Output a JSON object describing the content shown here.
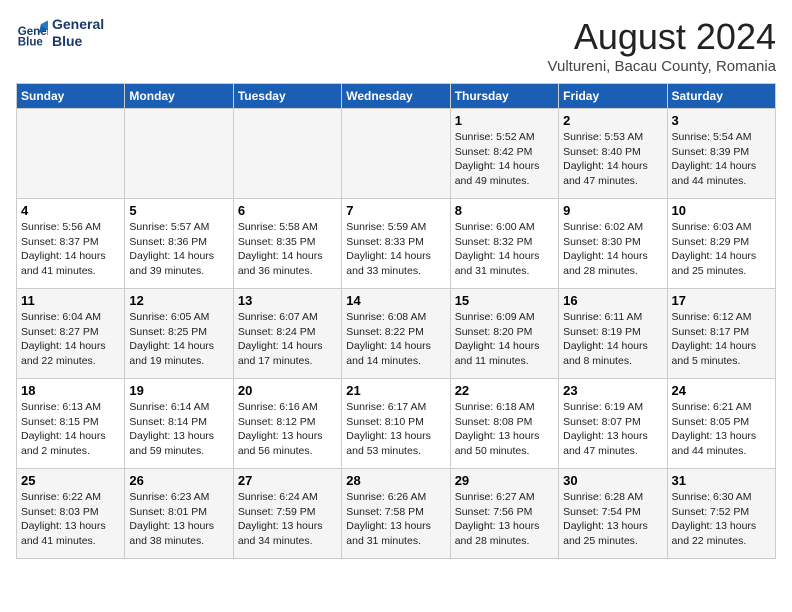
{
  "header": {
    "logo_line1": "General",
    "logo_line2": "Blue",
    "month_year": "August 2024",
    "location": "Vultureni, Bacau County, Romania"
  },
  "weekdays": [
    "Sunday",
    "Monday",
    "Tuesday",
    "Wednesday",
    "Thursday",
    "Friday",
    "Saturday"
  ],
  "weeks": [
    [
      {
        "day": "",
        "info": ""
      },
      {
        "day": "",
        "info": ""
      },
      {
        "day": "",
        "info": ""
      },
      {
        "day": "",
        "info": ""
      },
      {
        "day": "1",
        "info": "Sunrise: 5:52 AM\nSunset: 8:42 PM\nDaylight: 14 hours and 49 minutes."
      },
      {
        "day": "2",
        "info": "Sunrise: 5:53 AM\nSunset: 8:40 PM\nDaylight: 14 hours and 47 minutes."
      },
      {
        "day": "3",
        "info": "Sunrise: 5:54 AM\nSunset: 8:39 PM\nDaylight: 14 hours and 44 minutes."
      }
    ],
    [
      {
        "day": "4",
        "info": "Sunrise: 5:56 AM\nSunset: 8:37 PM\nDaylight: 14 hours and 41 minutes."
      },
      {
        "day": "5",
        "info": "Sunrise: 5:57 AM\nSunset: 8:36 PM\nDaylight: 14 hours and 39 minutes."
      },
      {
        "day": "6",
        "info": "Sunrise: 5:58 AM\nSunset: 8:35 PM\nDaylight: 14 hours and 36 minutes."
      },
      {
        "day": "7",
        "info": "Sunrise: 5:59 AM\nSunset: 8:33 PM\nDaylight: 14 hours and 33 minutes."
      },
      {
        "day": "8",
        "info": "Sunrise: 6:00 AM\nSunset: 8:32 PM\nDaylight: 14 hours and 31 minutes."
      },
      {
        "day": "9",
        "info": "Sunrise: 6:02 AM\nSunset: 8:30 PM\nDaylight: 14 hours and 28 minutes."
      },
      {
        "day": "10",
        "info": "Sunrise: 6:03 AM\nSunset: 8:29 PM\nDaylight: 14 hours and 25 minutes."
      }
    ],
    [
      {
        "day": "11",
        "info": "Sunrise: 6:04 AM\nSunset: 8:27 PM\nDaylight: 14 hours and 22 minutes."
      },
      {
        "day": "12",
        "info": "Sunrise: 6:05 AM\nSunset: 8:25 PM\nDaylight: 14 hours and 19 minutes."
      },
      {
        "day": "13",
        "info": "Sunrise: 6:07 AM\nSunset: 8:24 PM\nDaylight: 14 hours and 17 minutes."
      },
      {
        "day": "14",
        "info": "Sunrise: 6:08 AM\nSunset: 8:22 PM\nDaylight: 14 hours and 14 minutes."
      },
      {
        "day": "15",
        "info": "Sunrise: 6:09 AM\nSunset: 8:20 PM\nDaylight: 14 hours and 11 minutes."
      },
      {
        "day": "16",
        "info": "Sunrise: 6:11 AM\nSunset: 8:19 PM\nDaylight: 14 hours and 8 minutes."
      },
      {
        "day": "17",
        "info": "Sunrise: 6:12 AM\nSunset: 8:17 PM\nDaylight: 14 hours and 5 minutes."
      }
    ],
    [
      {
        "day": "18",
        "info": "Sunrise: 6:13 AM\nSunset: 8:15 PM\nDaylight: 14 hours and 2 minutes."
      },
      {
        "day": "19",
        "info": "Sunrise: 6:14 AM\nSunset: 8:14 PM\nDaylight: 13 hours and 59 minutes."
      },
      {
        "day": "20",
        "info": "Sunrise: 6:16 AM\nSunset: 8:12 PM\nDaylight: 13 hours and 56 minutes."
      },
      {
        "day": "21",
        "info": "Sunrise: 6:17 AM\nSunset: 8:10 PM\nDaylight: 13 hours and 53 minutes."
      },
      {
        "day": "22",
        "info": "Sunrise: 6:18 AM\nSunset: 8:08 PM\nDaylight: 13 hours and 50 minutes."
      },
      {
        "day": "23",
        "info": "Sunrise: 6:19 AM\nSunset: 8:07 PM\nDaylight: 13 hours and 47 minutes."
      },
      {
        "day": "24",
        "info": "Sunrise: 6:21 AM\nSunset: 8:05 PM\nDaylight: 13 hours and 44 minutes."
      }
    ],
    [
      {
        "day": "25",
        "info": "Sunrise: 6:22 AM\nSunset: 8:03 PM\nDaylight: 13 hours and 41 minutes."
      },
      {
        "day": "26",
        "info": "Sunrise: 6:23 AM\nSunset: 8:01 PM\nDaylight: 13 hours and 38 minutes."
      },
      {
        "day": "27",
        "info": "Sunrise: 6:24 AM\nSunset: 7:59 PM\nDaylight: 13 hours and 34 minutes."
      },
      {
        "day": "28",
        "info": "Sunrise: 6:26 AM\nSunset: 7:58 PM\nDaylight: 13 hours and 31 minutes."
      },
      {
        "day": "29",
        "info": "Sunrise: 6:27 AM\nSunset: 7:56 PM\nDaylight: 13 hours and 28 minutes."
      },
      {
        "day": "30",
        "info": "Sunrise: 6:28 AM\nSunset: 7:54 PM\nDaylight: 13 hours and 25 minutes."
      },
      {
        "day": "31",
        "info": "Sunrise: 6:30 AM\nSunset: 7:52 PM\nDaylight: 13 hours and 22 minutes."
      }
    ]
  ]
}
